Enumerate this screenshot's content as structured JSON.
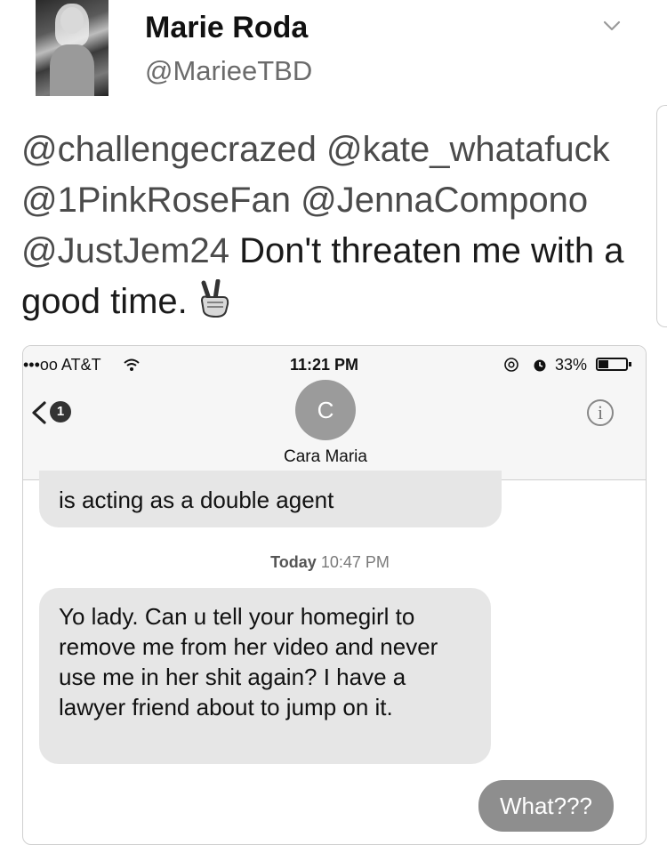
{
  "tweet": {
    "display_name": "Marie Roda",
    "handle": "@MarieeTBD",
    "mentions": [
      "@challengecrazed",
      "@kate_whatafuck",
      "@1PinkRoseFan",
      "@JennaCompono",
      "@JustJem24"
    ],
    "text": "Don't threaten me with a good time.",
    "emoji": "victory-hand"
  },
  "screenshot": {
    "status_bar": {
      "carrier": "•••oo AT&T",
      "time": "11:21 PM",
      "battery": "33%"
    },
    "nav": {
      "back_badge": "1",
      "contact_initial": "C",
      "contact_name": "Cara Maria"
    },
    "messages": {
      "partial_incoming": "is acting as a double agent",
      "timestamp_day": "Today",
      "timestamp_time": "10:47 PM",
      "incoming": "Yo lady. Can u tell your homegirl to remove me from her video and never use me in her shit again? I have a lawyer friend about to jump on it.",
      "outgoing": "What???"
    }
  }
}
